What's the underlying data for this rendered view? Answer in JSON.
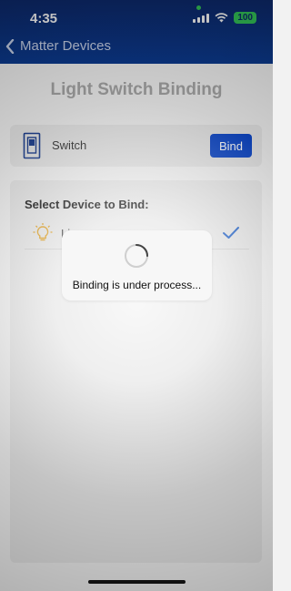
{
  "status_bar": {
    "time": "4:35",
    "battery": "100"
  },
  "nav": {
    "back_label": "Matter Devices"
  },
  "page": {
    "title": "Light Switch Binding"
  },
  "switch_card": {
    "label": "Switch",
    "bind_label": "Bind"
  },
  "device_panel": {
    "heading": "Select Device to Bind:",
    "devices": [
      {
        "name": "Li...",
        "selected": true
      }
    ]
  },
  "dialog": {
    "message": "Binding is under process..."
  },
  "colors": {
    "header": "#0b3a8f",
    "accent": "#0d47c8",
    "battery": "#34c759"
  }
}
